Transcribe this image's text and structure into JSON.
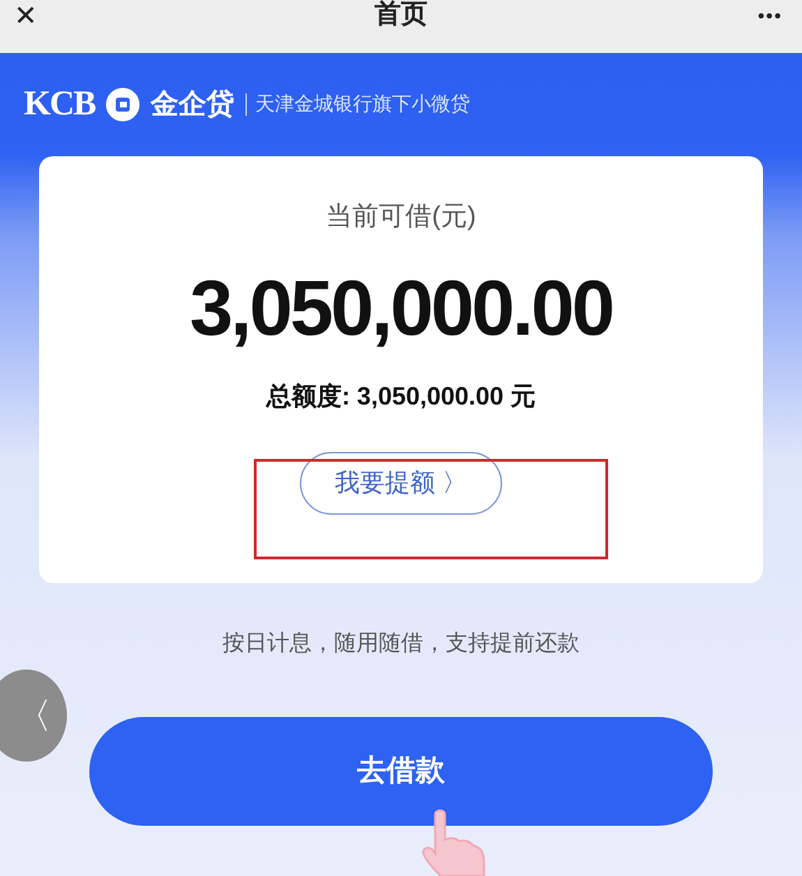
{
  "title_bar": {
    "close": "✕",
    "title": "首页",
    "more": "•••"
  },
  "header": {
    "brand": "KCB",
    "product": "金企贷",
    "tagline": "天津金城银行旗下小微贷"
  },
  "card": {
    "label": "当前可借(元)",
    "amount": "3,050,000.00",
    "total_label": "总额度:",
    "total_value": "3,050,000.00 元",
    "raise_button": "我要提额",
    "raise_arrow": "〉"
  },
  "note": "按日计息，随用随借，支持提前还款",
  "borrow_button": "去借款",
  "back_button": "〈"
}
